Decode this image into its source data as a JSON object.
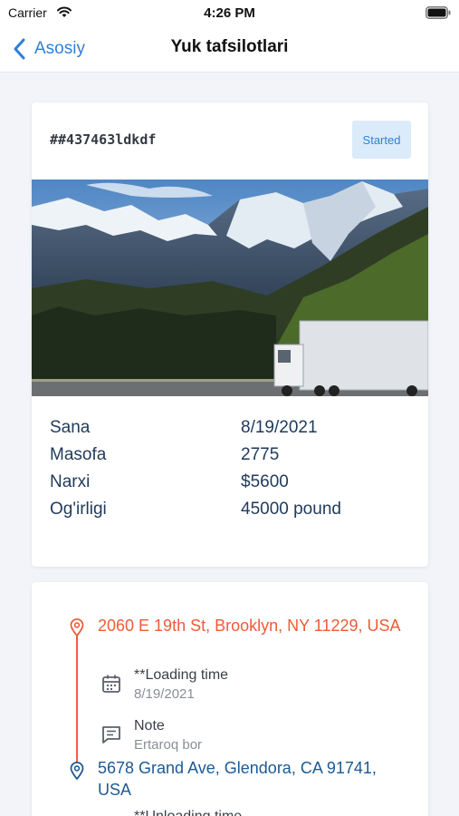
{
  "status_bar": {
    "carrier": "Carrier",
    "time": "4:26 PM"
  },
  "nav": {
    "back_label": "Asosiy",
    "title": "Yuk tafsilotlari"
  },
  "load": {
    "id": "##437463ldkdf",
    "status": "Started",
    "details": [
      {
        "label": "Sana",
        "value": "8/19/2021"
      },
      {
        "label": "Masofa",
        "value": "2775"
      },
      {
        "label": "Narxi",
        "value": "$5600"
      },
      {
        "label": "Og'irligi",
        "value": "45000 pound"
      }
    ]
  },
  "route": {
    "pickup_address": "2060 E 19th St, Brooklyn, NY 11229, USA",
    "loading_label": "**Loading time",
    "loading_date": "8/19/2021",
    "note_label": "Note",
    "note_text": "Ertaroq bor",
    "dropoff_address": "5678 Grand Ave, Glendora, CA 91741, USA",
    "unloading_label": "**Unloading time"
  },
  "colors": {
    "accent": "#2f7fd8",
    "pickup": "#ee5b36",
    "dropoff": "#1c5a94",
    "badge_bg": "#dcebfa"
  }
}
